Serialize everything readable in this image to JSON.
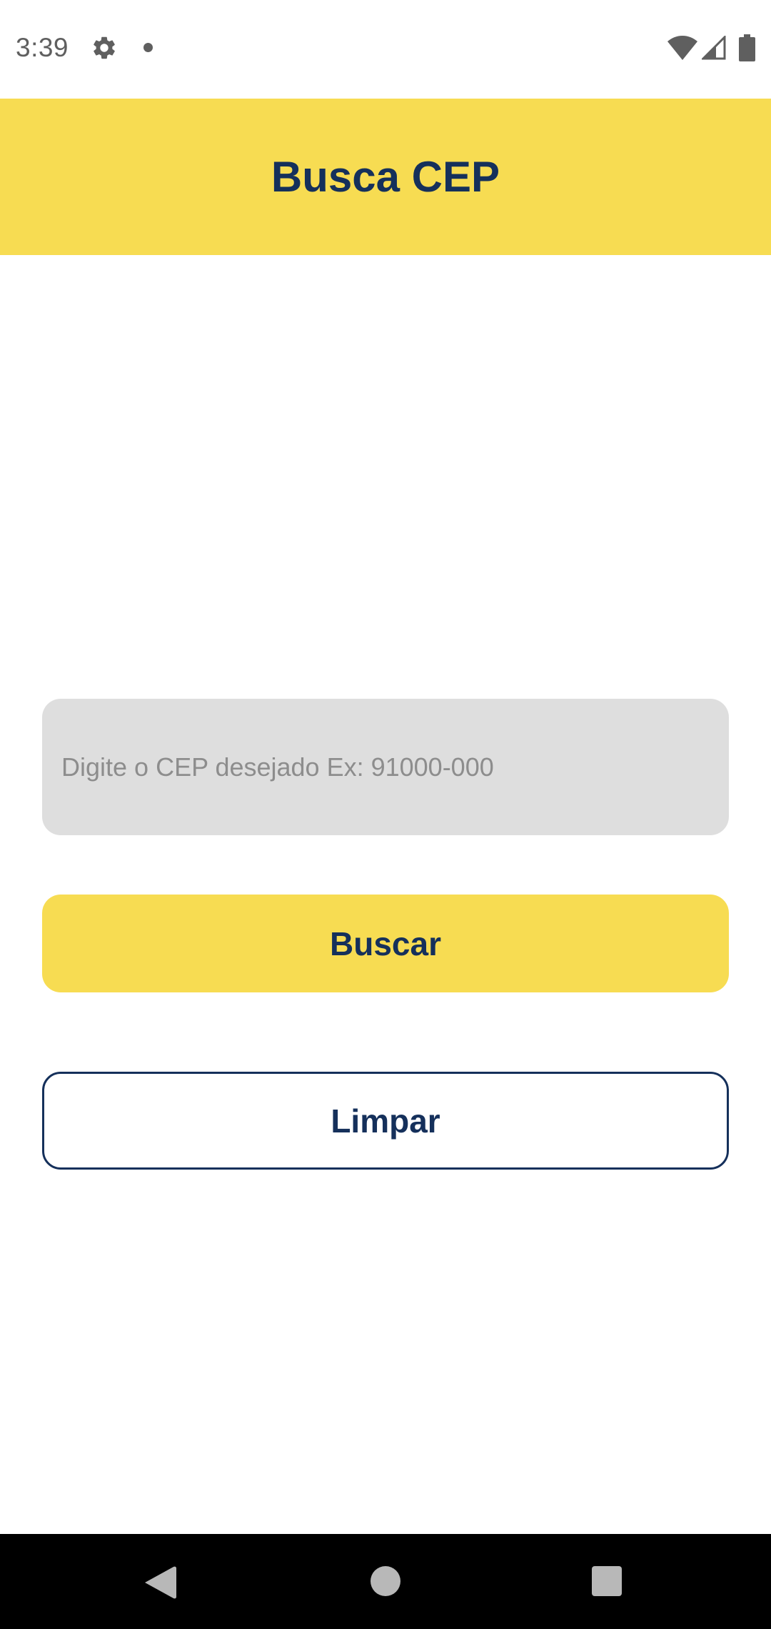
{
  "status_bar": {
    "time": "3:39",
    "icons": [
      "gear-icon",
      "notification-dot-icon",
      "wifi-icon",
      "cell-signal-icon",
      "battery-icon"
    ]
  },
  "app_bar": {
    "title": "Busca CEP",
    "background_color": "#f7dc52",
    "text_color": "#15305b"
  },
  "form": {
    "cep_input": {
      "value": "",
      "placeholder": "Digite o CEP desejado Ex: 91000-000"
    },
    "search_button_label": "Buscar",
    "clear_button_label": "Limpar"
  },
  "nav_bar": {
    "icons": [
      "back-icon",
      "home-icon",
      "recents-icon"
    ]
  },
  "colors": {
    "accent": "#f7dc52",
    "primary_text": "#15305b",
    "input_background": "#dedede"
  }
}
